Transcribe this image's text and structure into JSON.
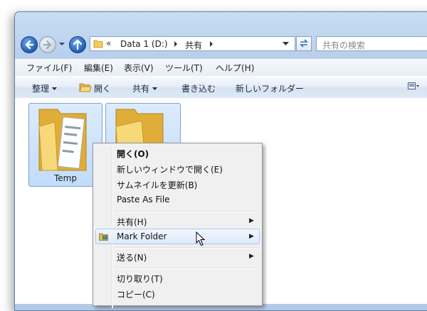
{
  "address": {
    "overflow": "«",
    "segment1": "Data 1 (D:)",
    "segment2": "共有"
  },
  "search": {
    "placeholder": "共有の検索"
  },
  "menubar": [
    "ファイル(F)",
    "編集(E)",
    "表示(V)",
    "ツール(T)",
    "ヘルプ(H)"
  ],
  "commands": {
    "organize": "整理",
    "open": "開く",
    "share": "共有",
    "burn": "書き込む",
    "new_folder": "新しいフォルダー"
  },
  "files": [
    {
      "name": "Temp"
    },
    {
      "name": ""
    }
  ],
  "context_menu": {
    "open": "開く(O)",
    "open_new_window": "新しいウィンドウで開く(E)",
    "refresh_thumbnail": "サムネイルを更新(B)",
    "paste_as_file": "Paste As File",
    "share": "共有(H)",
    "mark_folder": "Mark Folder",
    "send_to": "送る(N)",
    "cut": "切り取り(T)",
    "copy": "コピー(C)"
  },
  "icons": {
    "back": "back-arrow-icon",
    "forward": "forward-arrow-icon",
    "up": "up-arrow-icon",
    "refresh": "refresh-icon",
    "view": "view-icon",
    "mark_folder": "mark-folder-icon"
  }
}
